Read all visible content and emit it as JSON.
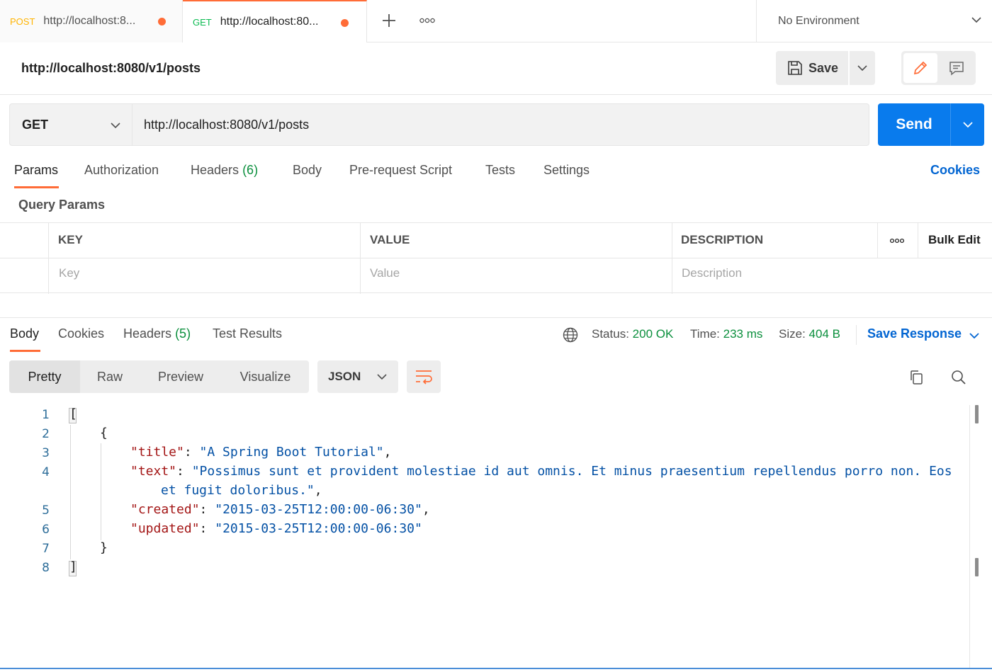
{
  "tabs": [
    {
      "method": "POST",
      "url": "http://localhost:8..."
    },
    {
      "method": "GET",
      "url": "http://localhost:80..."
    }
  ],
  "environment": "No Environment",
  "request": {
    "title": "http://localhost:8080/v1/posts",
    "save_label": "Save",
    "method": "GET",
    "url": "http://localhost:8080/v1/posts",
    "send_label": "Send"
  },
  "request_tabs": {
    "params": "Params",
    "authorization": "Authorization",
    "headers": "Headers",
    "headers_count": "(6)",
    "body": "Body",
    "pre_request": "Pre-request Script",
    "tests": "Tests",
    "settings": "Settings",
    "cookies": "Cookies"
  },
  "query_params": {
    "label": "Query Params",
    "columns": {
      "key": "KEY",
      "value": "VALUE",
      "description": "DESCRIPTION"
    },
    "bulk_edit": "Bulk Edit",
    "placeholders": {
      "key": "Key",
      "value": "Value",
      "description": "Description"
    }
  },
  "response": {
    "tabs": {
      "body": "Body",
      "cookies": "Cookies",
      "headers": "Headers",
      "headers_count": "(5)",
      "test_results": "Test Results"
    },
    "status_label": "Status:",
    "status_value": "200 OK",
    "time_label": "Time:",
    "time_value": "233 ms",
    "size_label": "Size:",
    "size_value": "404 B",
    "save_response": "Save Response",
    "views": {
      "pretty": "Pretty",
      "raw": "Raw",
      "preview": "Preview",
      "visualize": "Visualize"
    },
    "format": "JSON"
  },
  "code": {
    "line_numbers": [
      "1",
      "2",
      "3",
      "4",
      "5",
      "6",
      "7",
      "8"
    ],
    "open_array": "[",
    "open_obj": "{",
    "title_key": "\"title\"",
    "title_val": "\"A Spring Boot Tutorial\"",
    "text_key": "\"text\"",
    "text_val_1": "\"Possimus sunt et provident molestiae id aut omnis. Et minus praesentium repellendus porro non. Eos",
    "text_val_2": "et fugit doloribus.\"",
    "created_key": "\"created\"",
    "created_val": "\"2015-03-25T12:00:00-06:30\"",
    "updated_key": "\"updated\"",
    "updated_val": "\"2015-03-25T12:00:00-06:30\"",
    "close_obj": "}",
    "close_array": "]"
  },
  "colors": {
    "accent": "#ff6c37",
    "send": "#097bed",
    "link": "#0265d2",
    "success": "#0b8f3d"
  }
}
